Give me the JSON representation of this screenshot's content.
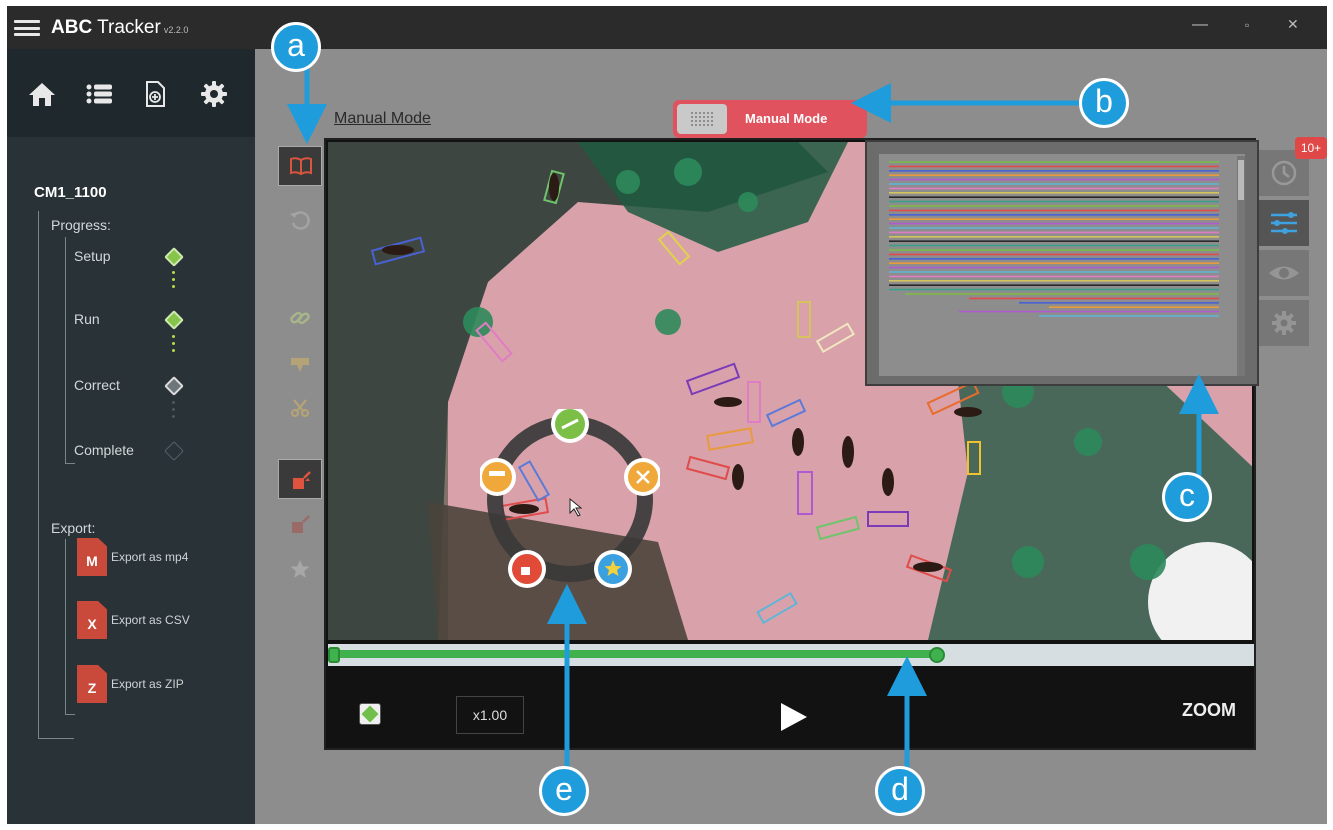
{
  "app": {
    "title_bold": "ABC",
    "title_rest": "Tracker",
    "version": "v2.2.0",
    "window_controls": [
      "—",
      "▫",
      "✕"
    ]
  },
  "sidebar": {
    "nav_icons": [
      "home-icon",
      "list-icon",
      "new-file-icon",
      "gear-icon"
    ],
    "project_name": "CM1_1100",
    "progress_label": "Progress:",
    "steps": [
      {
        "label": "Setup",
        "status": "done"
      },
      {
        "label": "Run",
        "status": "done"
      },
      {
        "label": "Correct",
        "status": "current"
      },
      {
        "label": "Complete",
        "status": "pending"
      }
    ],
    "export_label": "Export:",
    "exports": [
      {
        "label": "Export as mp4",
        "icon_letter": "M"
      },
      {
        "label": "Export as CSV",
        "icon_letter": "X"
      },
      {
        "label": "Export as ZIP",
        "icon_letter": "Z"
      }
    ]
  },
  "main": {
    "mode_label": "Manual Mode",
    "mode_toggle_label": "Manual Mode",
    "notification_badge": "10+",
    "playback_speed": "x1.00",
    "zoom_label": "ZOOM",
    "progress": 0.66
  },
  "callouts": {
    "a": "a",
    "b": "b",
    "c": "c",
    "d": "d",
    "e": "e"
  },
  "colors": {
    "accent_blue": "#1f9cdb",
    "mode_red": "#e0535e",
    "progress_green": "#40b24d",
    "sidebar_dark": "#283237"
  }
}
